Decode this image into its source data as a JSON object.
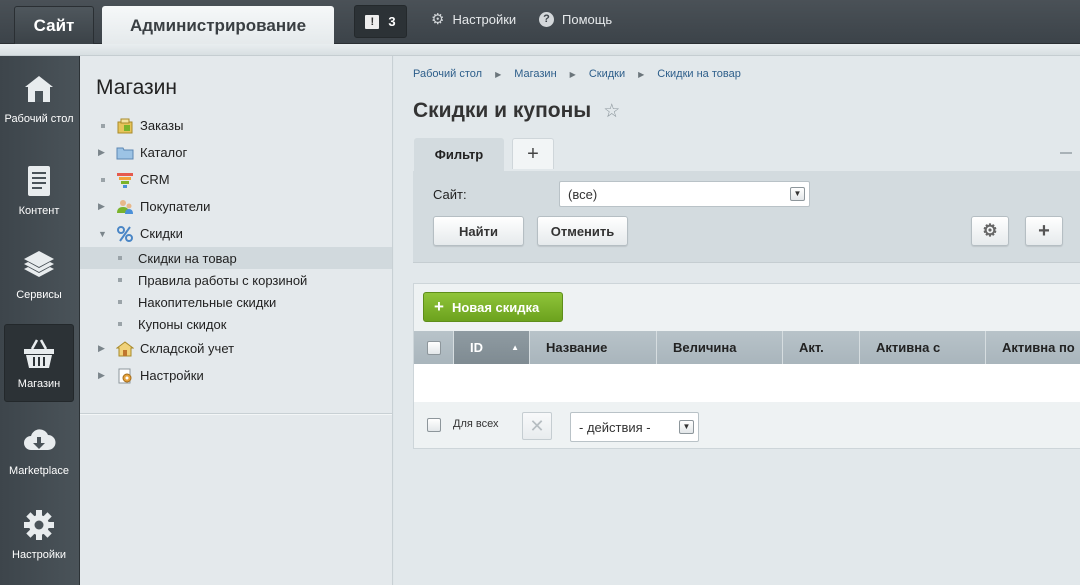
{
  "topbar": {
    "site_tab": "Сайт",
    "admin_tab": "Администрирование",
    "notifications_count": "3",
    "settings_label": "Настройки",
    "help_label": "Помощь"
  },
  "leftmenu": {
    "items": [
      {
        "label": "Рабочий стол",
        "icon": "home-icon"
      },
      {
        "label": "Контент",
        "icon": "document-icon"
      },
      {
        "label": "Сервисы",
        "icon": "layers-icon"
      },
      {
        "label": "Магазин",
        "icon": "basket-icon",
        "active": true
      },
      {
        "label": "Marketplace",
        "icon": "cloud-download-icon"
      },
      {
        "label": "Настройки",
        "icon": "gear-icon"
      }
    ]
  },
  "panel": {
    "title": "Магазин",
    "items": [
      {
        "label": "Заказы",
        "icon": "orders-icon",
        "marker": "dot"
      },
      {
        "label": "Каталог",
        "icon": "folder-icon",
        "marker": "arrow"
      },
      {
        "label": "CRM",
        "icon": "funnel-icon",
        "marker": "dot"
      },
      {
        "label": "Покупатели",
        "icon": "users-icon",
        "marker": "arrow"
      },
      {
        "label": "Скидки",
        "icon": "percent-icon",
        "marker": "expanded"
      }
    ],
    "subitems": [
      {
        "label": "Скидки на товар",
        "selected": true
      },
      {
        "label": "Правила работы с корзиной"
      },
      {
        "label": "Накопительные скидки"
      },
      {
        "label": "Купоны скидок"
      }
    ],
    "items_after": [
      {
        "label": "Складской учет",
        "icon": "warehouse-icon",
        "marker": "arrow"
      },
      {
        "label": "Настройки",
        "icon": "settings-doc-icon",
        "marker": "arrow"
      }
    ]
  },
  "breadcrumbs": [
    "Рабочий стол",
    "Магазин",
    "Скидки",
    "Скидки на товар"
  ],
  "page": {
    "title": "Скидки и купоны"
  },
  "filter": {
    "tab_label": "Фильтр",
    "add_tab": "+",
    "site_label": "Сайт:",
    "site_value": "(все)",
    "find_button": "Найти",
    "cancel_button": "Отменить"
  },
  "list": {
    "new_button": "Новая скидка",
    "columns": [
      "ID",
      "Название",
      "Величина",
      "Акт.",
      "Активна с",
      "Активна по"
    ],
    "footer_all": "Для всех",
    "actions_value": "- действия -"
  },
  "colors": {
    "accent_green": "#7ab32b",
    "topbar": "#42494f"
  }
}
